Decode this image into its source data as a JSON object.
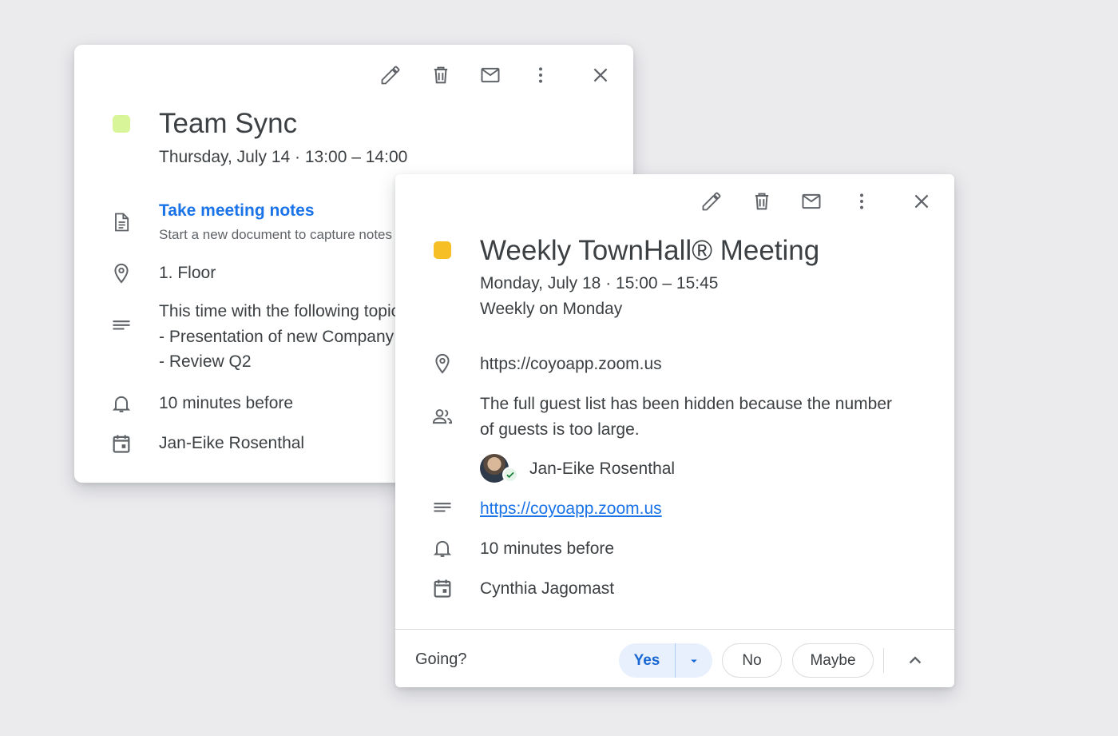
{
  "colors": {
    "card1_swatch": "#d9f59a",
    "card2_swatch": "#f6bf26",
    "link": "#1a73e8",
    "yes_bg": "#e8f0fe",
    "yes_text": "#1967d2"
  },
  "card1": {
    "toolbar": [
      "edit-icon",
      "delete-icon",
      "email-icon",
      "more-vert-icon",
      "close-icon"
    ],
    "title": "Team Sync",
    "datetime": "Thursday, July 14  ·  13:00 – 14:00",
    "notes_link": "Take meeting notes",
    "notes_sub": "Start a new document to capture notes",
    "location": "1. Floor",
    "description_lines": [
      "This time with the following topics:",
      "- Presentation of new Company",
      "- Review Q2"
    ],
    "reminder": "10 minutes before",
    "organizer": "Jan-Eike Rosenthal"
  },
  "card2": {
    "toolbar": [
      "edit-icon",
      "delete-icon",
      "email-icon",
      "more-vert-icon",
      "close-icon"
    ],
    "title": "Weekly TownHall® Meeting",
    "datetime": "Monday, July 18  ·  15:00 – 15:45",
    "recurrence": "Weekly on Monday",
    "location": "https://coyoapp.zoom.us",
    "guests_line1": "The full guest list has been hidden because the number",
    "guests_line2": "of guests is too large.",
    "guest_name": "Jan-Eike Rosenthal",
    "description_link": "https://coyoapp.zoom.us",
    "reminder": "10 minutes before",
    "organizer": "Cynthia Jagomast",
    "footer": {
      "going_label": "Going?",
      "yes_label": "Yes",
      "no_label": "No",
      "maybe_label": "Maybe"
    }
  }
}
